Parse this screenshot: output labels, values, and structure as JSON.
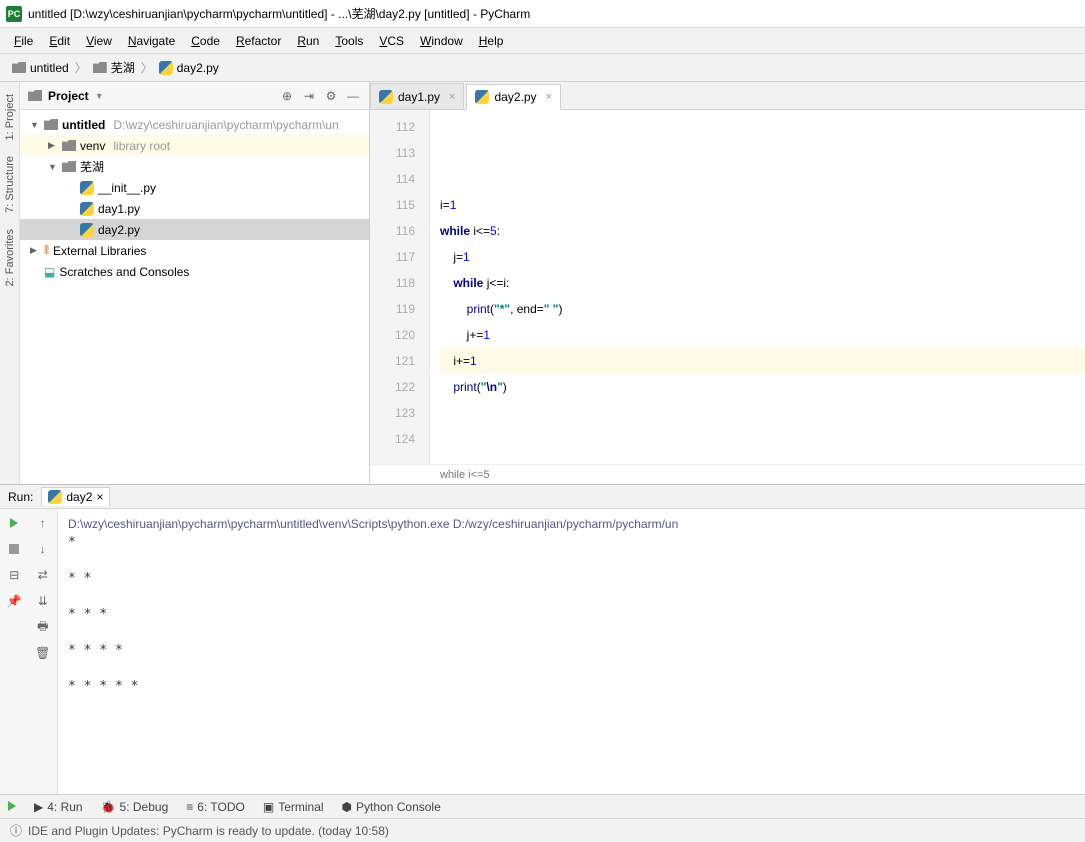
{
  "title": "untitled [D:\\wzy\\ceshiruanjian\\pycharm\\pycharm\\untitled] - ...\\芜湖\\day2.py [untitled] - PyCharm",
  "menu": [
    "File",
    "Edit",
    "View",
    "Navigate",
    "Code",
    "Refactor",
    "Run",
    "Tools",
    "VCS",
    "Window",
    "Help"
  ],
  "breadcrumbs": [
    {
      "icon": "folder",
      "label": "untitled"
    },
    {
      "icon": "folder",
      "label": "芜湖"
    },
    {
      "icon": "python",
      "label": "day2.py"
    }
  ],
  "project_title": "Project",
  "tree": [
    {
      "depth": 0,
      "arrow": "▼",
      "icon": "folder",
      "label": "untitled",
      "suffix": "D:\\wzy\\ceshiruanjian\\pycharm\\pycharm\\un",
      "bold": true
    },
    {
      "depth": 1,
      "arrow": "▶",
      "icon": "folder",
      "label": "venv",
      "suffix": "library root",
      "highlight": true
    },
    {
      "depth": 1,
      "arrow": "▼",
      "icon": "folder",
      "label": "芜湖"
    },
    {
      "depth": 2,
      "arrow": "",
      "icon": "python",
      "label": "__init__.py"
    },
    {
      "depth": 2,
      "arrow": "",
      "icon": "python",
      "label": "day1.py"
    },
    {
      "depth": 2,
      "arrow": "",
      "icon": "python",
      "label": "day2.py",
      "selected": true
    },
    {
      "depth": 0,
      "arrow": "▶",
      "icon": "lib",
      "label": "External Libraries"
    },
    {
      "depth": 0,
      "arrow": "",
      "icon": "scratch",
      "label": "Scratches and Consoles"
    }
  ],
  "editor_tabs": [
    {
      "icon": "python",
      "label": "day1.py",
      "active": false
    },
    {
      "icon": "python",
      "label": "day2.py",
      "active": true
    }
  ],
  "code_start_line": 112,
  "code_lines": [
    {
      "n": 112,
      "html": ""
    },
    {
      "n": 113,
      "html": ""
    },
    {
      "n": 114,
      "html": ""
    },
    {
      "n": 115,
      "html": "i=<span class='num'>1</span>"
    },
    {
      "n": 116,
      "html": "<span class='kw'>while</span> i&lt;=<span class='num'>5</span>:"
    },
    {
      "n": 117,
      "html": "    j=<span class='num'>1</span>"
    },
    {
      "n": 118,
      "html": "    <span class='kw'>while</span> j&lt;=i:"
    },
    {
      "n": 119,
      "html": "        <span class='fn'>print</span>(<span class='str'>\"*\"</span>, end=<span class='str'>\" \"</span>)"
    },
    {
      "n": 120,
      "html": "        j+=<span class='num'>1</span>"
    },
    {
      "n": 121,
      "html": "    i+=<span class='num'>1</span>",
      "current": true
    },
    {
      "n": 122,
      "html": "    <span class='fn'>print</span>(<span class='str'>\"<span class='kw'>\\n</span>\"</span>)"
    },
    {
      "n": 123,
      "html": ""
    },
    {
      "n": 124,
      "html": ""
    }
  ],
  "breadcrumb_status": "while i<=5",
  "run": {
    "label": "Run:",
    "tab": "day2",
    "command": "D:\\wzy\\ceshiruanjian\\pycharm\\pycharm\\untitled\\venv\\Scripts\\python.exe D:/wzy/ceshiruanjian/pycharm/pycharm/un",
    "output": "* \n\n* * \n\n* * * \n\n* * * * \n\n* * * * * "
  },
  "bottom_tools": [
    {
      "icon": "▶",
      "label": "4: Run"
    },
    {
      "icon": "🐞",
      "label": "5: Debug"
    },
    {
      "icon": "≡",
      "label": "6: TODO"
    },
    {
      "icon": "▣",
      "label": "Terminal"
    },
    {
      "icon": "⬢",
      "label": "Python Console"
    }
  ],
  "left_tabs": [
    "1: Project",
    "7: Structure",
    "2: Favorites"
  ],
  "status": "IDE and Plugin Updates: PyCharm is ready to update. (today 10:58)"
}
